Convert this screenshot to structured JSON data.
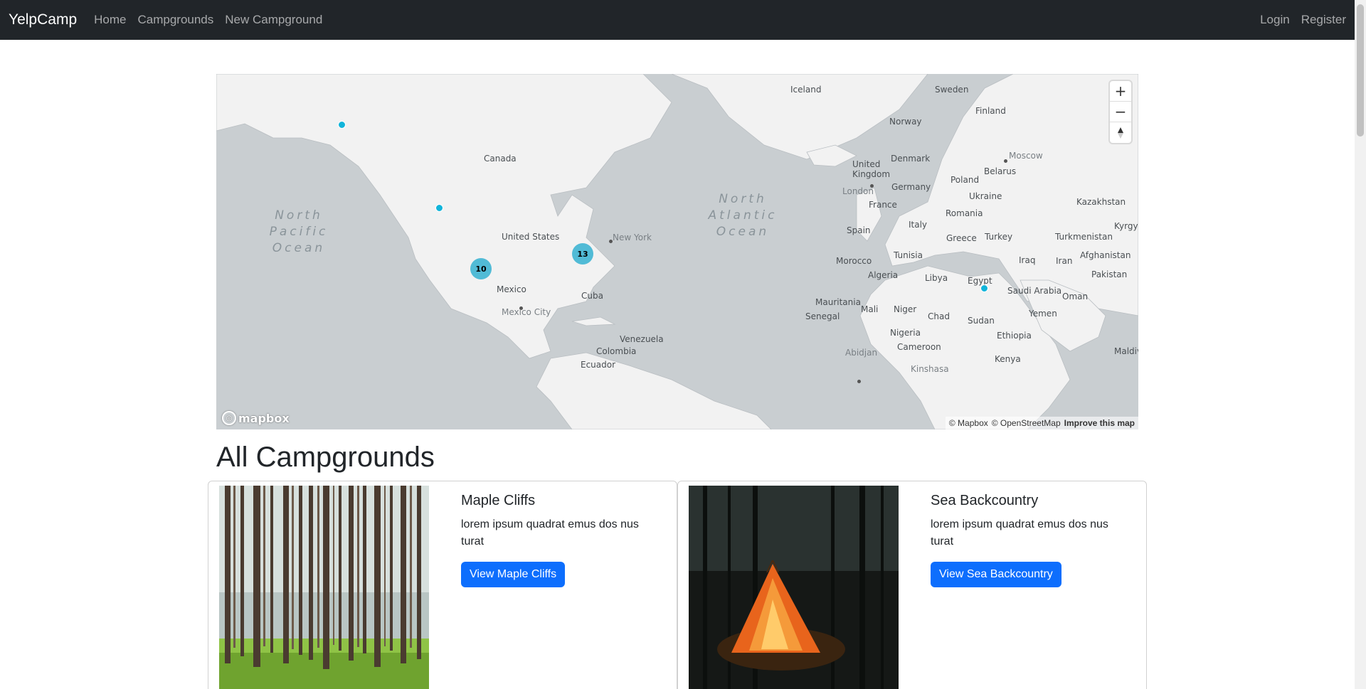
{
  "navbar": {
    "brand": "YelpCamp",
    "links": [
      "Home",
      "Campgrounds",
      "New Campground"
    ],
    "auth": [
      "Login",
      "Register"
    ]
  },
  "map": {
    "oceans": {
      "pacific": "North\nPacific\nOcean",
      "atlantic": "North\nAtlantic\nOcean"
    },
    "places": {
      "iceland": "Iceland",
      "sweden": "Sweden",
      "finland": "Finland",
      "norway": "Norway",
      "canada": "Canada",
      "moscow": "Moscow",
      "denmark": "Denmark",
      "uk": "United\nKingdom",
      "belarus": "Belarus",
      "poland": "Poland",
      "germany": "Germany",
      "london": "London",
      "ukraine": "Ukraine",
      "kazakhstan": "Kazakhstan",
      "france": "France",
      "romania": "Romania",
      "usa": "United States",
      "newyork": "New York",
      "spain": "Spain",
      "italy": "Italy",
      "kyrgyz": "Kyrgyz",
      "greece": "Greece",
      "turkey": "Turkey",
      "turkmenistan": "Turkmenistan",
      "tunisia": "Tunisia",
      "afghanistan": "Afghanistan",
      "morocco": "Morocco",
      "iraq": "Iraq",
      "iran": "Iran",
      "algeria": "Algeria",
      "libya": "Libya",
      "egypt": "Egypt",
      "pakistan": "Pakistan",
      "mexico": "Mexico",
      "saudi": "Saudi Arabia",
      "oman": "Oman",
      "cuba": "Cuba",
      "mexicocity": "Mexico City",
      "mauritania": "Mauritania",
      "mali": "Mali",
      "niger": "Niger",
      "senegal": "Senegal",
      "chad": "Chad",
      "yemen": "Yemen",
      "sudan": "Sudan",
      "venezuela": "Venezuela",
      "nigeria": "Nigeria",
      "ethiopia": "Ethiopia",
      "colombia": "Colombia",
      "cameroon": "Cameroon",
      "abidjan": "Abidjan",
      "maldiv": "Maldiv",
      "ecuador": "Ecuador",
      "kinshasa": "Kinshasa",
      "kenya": "Kenya"
    },
    "clusters": [
      "10",
      "13"
    ],
    "zoom_in": "+",
    "zoom_out": "−",
    "logo": "mapbox",
    "attribution": [
      "© Mapbox",
      "© OpenStreetMap",
      "Improve this map"
    ]
  },
  "heading": "All Campgrounds",
  "campgrounds": [
    {
      "title": "Maple Cliffs",
      "description": "lorem ipsum quadrat emus dos nus turat",
      "button": "View Maple Cliffs"
    },
    {
      "title": "Sea Backcountry",
      "description": "lorem ipsum quadrat emus dos nus turat",
      "button": "View Sea Backcountry"
    }
  ]
}
